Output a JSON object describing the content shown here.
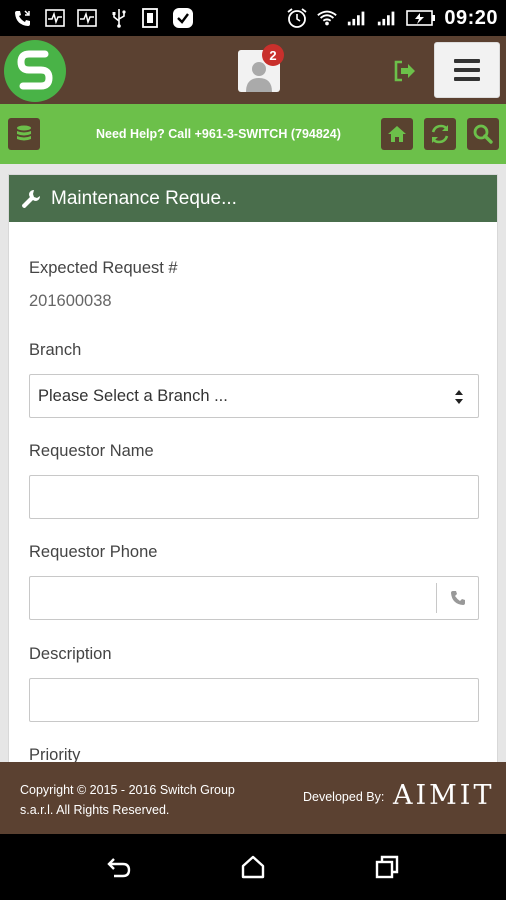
{
  "status_bar": {
    "time": "09:20",
    "icons": [
      "missed-call-icon",
      "activity-monitor-icon",
      "activity-monitor-icon",
      "usb-icon",
      "sim-icon",
      "check-icon",
      "alarm-icon",
      "wifi-icon",
      "signal-1-icon",
      "signal-2-icon",
      "battery-charging-icon"
    ]
  },
  "header": {
    "logo_icon": "switch-logo-icon",
    "notification_count": "2",
    "profile_icon": "user-icon",
    "logout_icon": "logout-icon",
    "menu_icon": "hamburger-menu-icon"
  },
  "help_bar": {
    "text": "Need Help? Call +961-3-SWITCH (794824)",
    "left_icon": "database-icon",
    "right_icons": [
      "home-icon",
      "refresh-icon",
      "search-icon"
    ]
  },
  "panel": {
    "title": "Maintenance Reque...",
    "title_icon": "wrench-icon",
    "fields": {
      "expected_request_label": "Expected Request #",
      "expected_request_value": "201600038",
      "branch_label": "Branch",
      "branch_value": "Please Select a Branch ...",
      "requestor_name_label": "Requestor Name",
      "requestor_name_value": "",
      "requestor_phone_label": "Requestor Phone",
      "requestor_phone_value": "",
      "description_label": "Description",
      "description_value": "",
      "priority_label": "Priority"
    }
  },
  "footer": {
    "copyright": "Copyright © 2015 - 2016 Switch Group s.a.r.l. All Rights Reserved.",
    "developed_by": "Developed By:",
    "developer": "AIMIT"
  },
  "navbar": {
    "icons": [
      "back-icon",
      "home-icon",
      "recent-apps-icon"
    ]
  },
  "colors": {
    "brown": "#5b4131",
    "green": "#6cc04a",
    "dark_green": "#4a6e4c",
    "logo_green": "#49b347",
    "badge_red": "#c9302c"
  }
}
